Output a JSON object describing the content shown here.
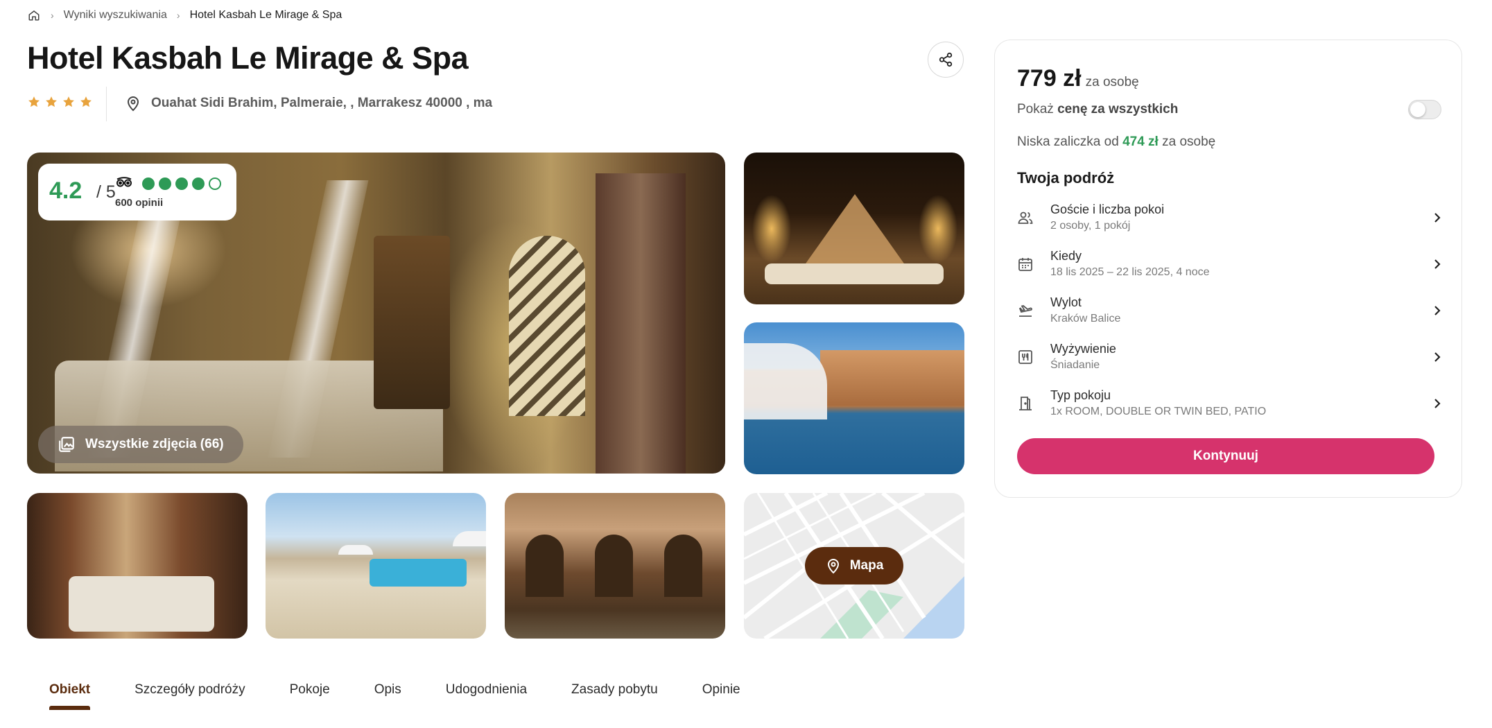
{
  "breadcrumb": {
    "home_icon": "home-icon",
    "items": [
      "Wyniki wyszukiwania",
      "Hotel Kasbah Le Mirage & Spa"
    ]
  },
  "hotel": {
    "name": "Hotel Kasbah Le Mirage & Spa",
    "stars": 4,
    "address": "Ouahat Sidi Brahim, Palmeraie, , Marrakesz 40000 , ma"
  },
  "rating": {
    "score": "4.2",
    "out_of": "/ 5",
    "dots_filled": 4,
    "dots_total": 5,
    "reviews": "600 opinii",
    "color": "#2e9a56"
  },
  "gallery": {
    "all_photos_label": "Wszystkie zdjęcia (66)",
    "map_label": "Mapa"
  },
  "tabs": [
    "Obiekt",
    "Szczegóły podróży",
    "Pokoje",
    "Opis",
    "Udogodnienia",
    "Zasady pobytu",
    "Opinie"
  ],
  "active_tab": "Obiekt",
  "booking": {
    "price": "779 zł",
    "price_unit": "za osobę",
    "toggle_prefix": "Pokaż ",
    "toggle_bold": "cenę za wszystkich",
    "toggle_on": false,
    "deposit_prefix": "Niska zaliczka od ",
    "deposit_amount": "474 zł",
    "deposit_suffix": " za osobę",
    "trip_title": "Twoja podróż",
    "trip_items": [
      {
        "icon": "users-icon",
        "title": "Goście i liczba pokoi",
        "value": "2 osoby, 1 pokój"
      },
      {
        "icon": "calendar-icon",
        "title": "Kiedy",
        "value": "18 lis 2025 – 22 lis 2025, 4 noce"
      },
      {
        "icon": "plane-icon",
        "title": "Wylot",
        "value": "Kraków Balice"
      },
      {
        "icon": "utensils-icon",
        "title": "Wyżywienie",
        "value": "Śniadanie"
      },
      {
        "icon": "door-icon",
        "title": "Typ pokoju",
        "value": "1x ROOM, DOUBLE OR TWIN BED, PATIO"
      }
    ],
    "continue_label": "Kontynuuj",
    "accent_color": "#d6336c"
  },
  "colors": {
    "brand_brown": "#5b2c0e",
    "star_color": "#e8a33d"
  }
}
